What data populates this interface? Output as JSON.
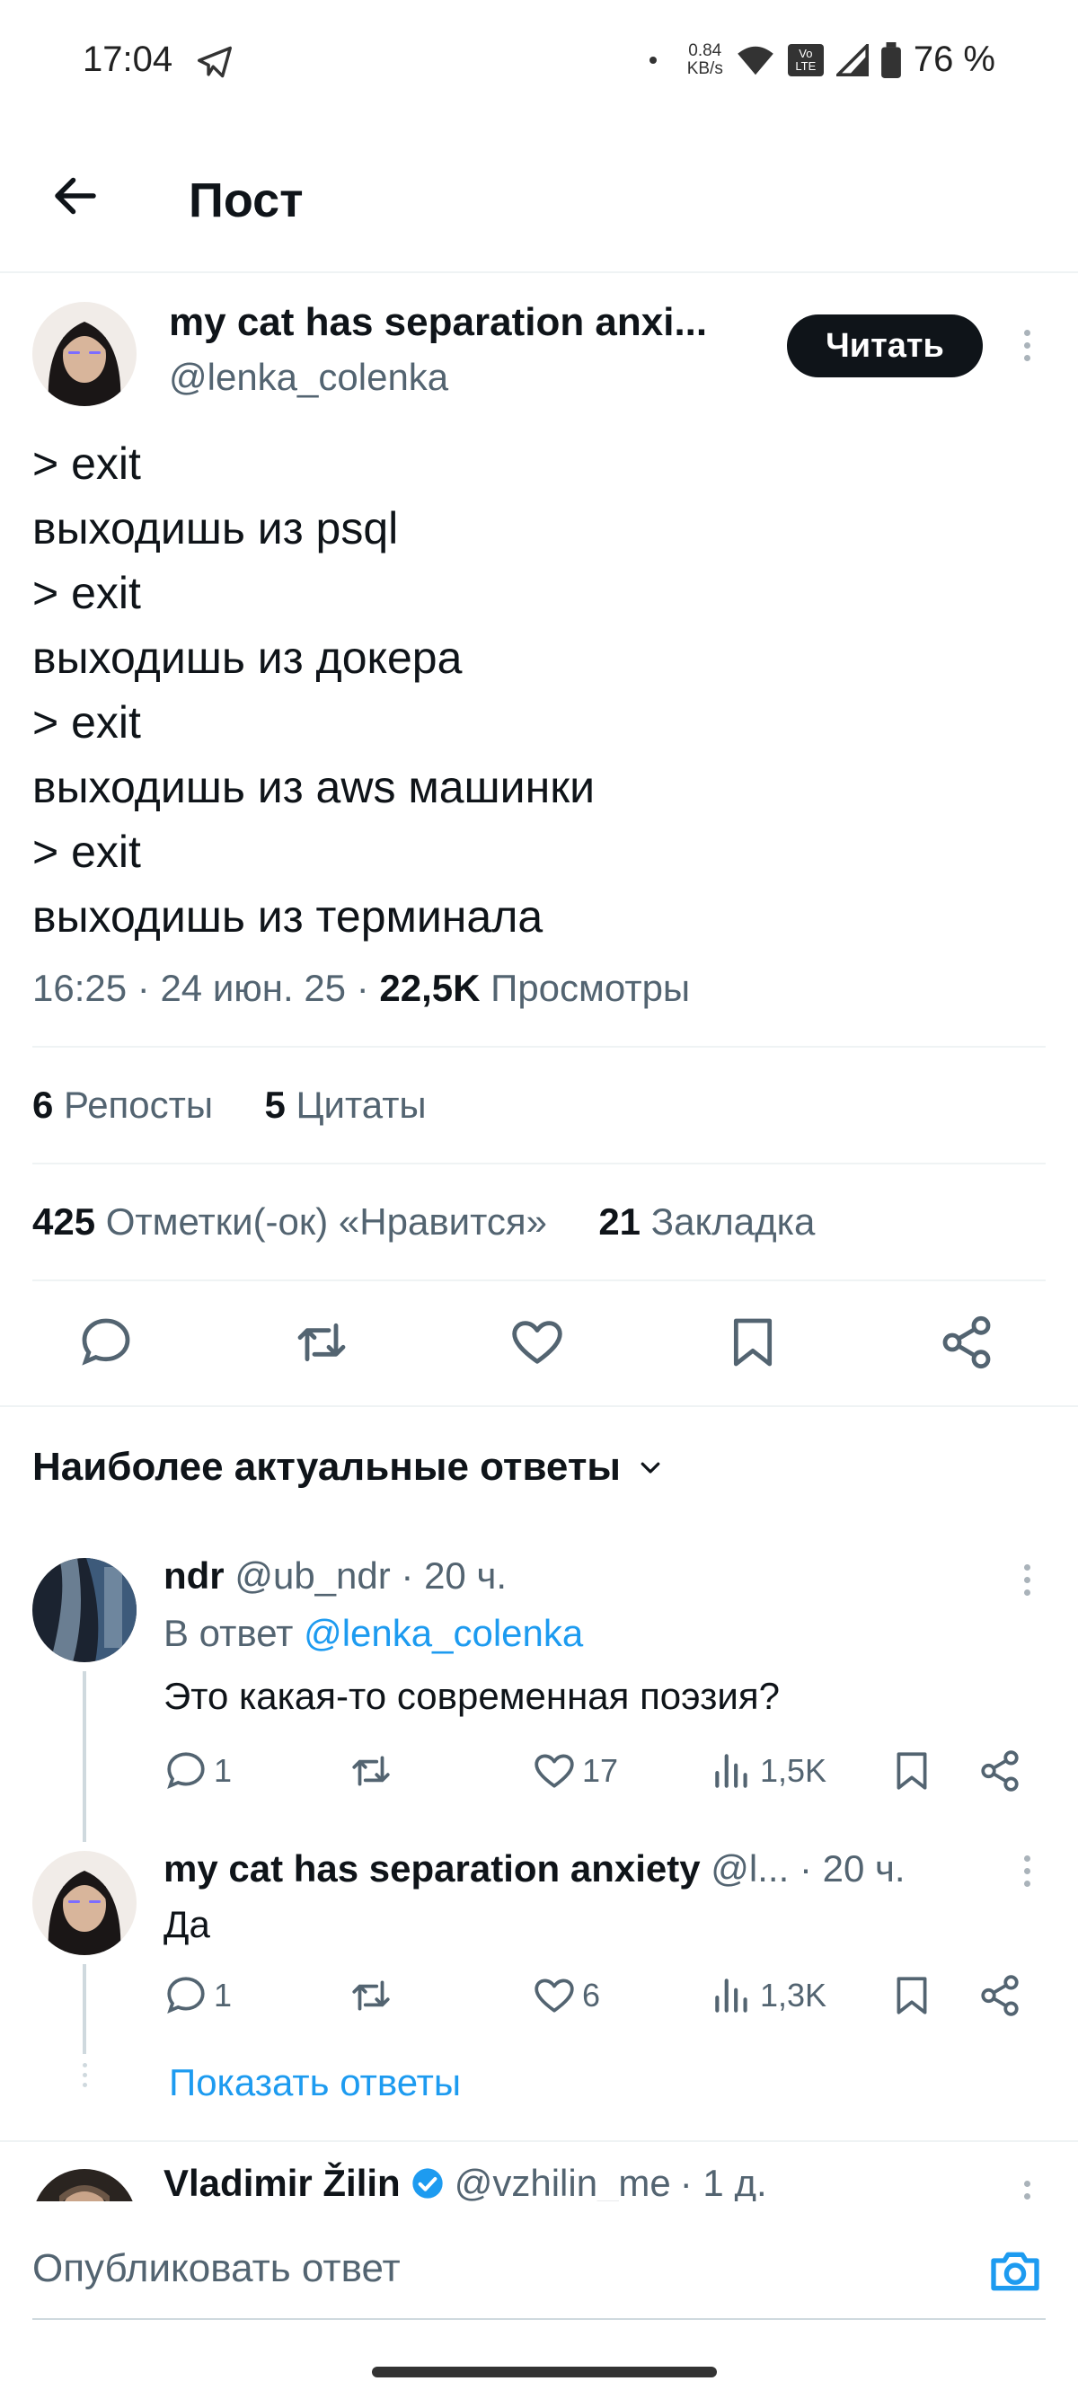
{
  "status_bar": {
    "time": "17:04",
    "speed_value": "0.84",
    "speed_unit": "KB/s",
    "volte": "Vo LTE",
    "battery": "76 %"
  },
  "header": {
    "title": "Пост"
  },
  "post": {
    "author_name": "my cat has separation anxi...",
    "author_handle": "@lenka_colenka",
    "follow_label": "Читать",
    "lines": [
      "> exit",
      "выходишь из psql",
      "> exit",
      "выходишь из докера",
      "> exit",
      "выходишь из aws машинки",
      "> exit",
      "выходишь из терминала"
    ],
    "time": "16:25",
    "date": "24 июн. 25",
    "views_count": "22,5K",
    "views_label": "Просмотры",
    "reposts_count": "6",
    "reposts_label": "Репосты",
    "quotes_count": "5",
    "quotes_label": "Цитаты",
    "likes_count": "425",
    "likes_label": "Отметки(-ок) «Нравится»",
    "bookmarks_count": "21",
    "bookmarks_label": "Закладка"
  },
  "sort": {
    "label": "Наиболее актуальные ответы"
  },
  "replies": [
    {
      "name": "ndr",
      "handle": "@ub_ndr",
      "time": "· 20 ч.",
      "reply_to_prefix": "В ответ",
      "reply_to_handle": "@lenka_colenka",
      "text": "Это какая-то современная поэзия?",
      "comments": "1",
      "likes": "17",
      "views": "1,5K"
    },
    {
      "name": "my cat has separation anxiety",
      "handle": "@l...",
      "time": "· 20 ч.",
      "text": "Да",
      "comments": "1",
      "likes": "6",
      "views": "1,3K"
    },
    {
      "name": "Vladimir Žilin",
      "handle": "@vzhilin_me",
      "time": "· 1 д."
    }
  ],
  "show_replies_label": "Показать ответы",
  "compose": {
    "placeholder": "Опубликовать ответ"
  },
  "colors": {
    "accent": "#1d9bf0",
    "text": "#0f1419",
    "muted": "#536471",
    "button": "#0f1419"
  }
}
